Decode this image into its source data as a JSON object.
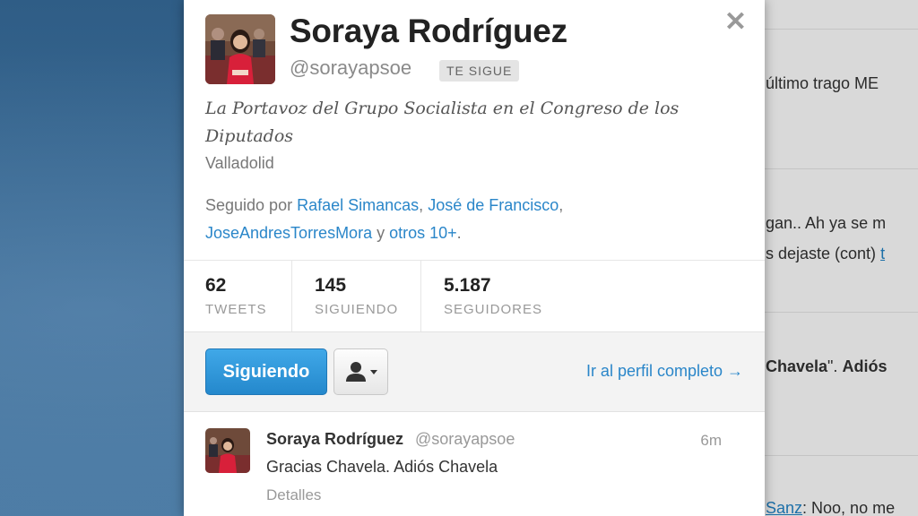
{
  "background_timeline": {
    "rows": [
      {
        "text": "último trago ME"
      },
      {
        "text": "gan.. Ah ya se m"
      },
      {
        "text_prefix": "s dejaste (cont) ",
        "link": "t"
      },
      {
        "quote_bold": "Chavela",
        "after": "\". ",
        "bold_tail": "Adiós"
      },
      {
        "link": "Sanz",
        "after": ": Noo, no me"
      }
    ]
  },
  "profile": {
    "name": "Soraya Rodríguez",
    "handle": "@sorayapsoe",
    "follows_you_badge": "TE SIGUE",
    "bio": "La Portavoz del Grupo Socialista en el Congreso de los Diputados",
    "location": "Valladolid",
    "followed_by": {
      "prefix": "Seguido por",
      "user1": "Rafael Simancas",
      "sep1": ",",
      "user2": "José de Francisco",
      "sep2": ",",
      "user3": "JoseAndresTorresMora",
      "conj": "y",
      "others": "otros 10+",
      "end": "."
    },
    "close_icon": "close-icon"
  },
  "stats": [
    {
      "value": "62",
      "label": "TWEETS"
    },
    {
      "value": "145",
      "label": "SIGUIENDO"
    },
    {
      "value": "5.187",
      "label": "SEGUIDORES"
    }
  ],
  "actions": {
    "following_label": "Siguiendo",
    "user_menu_icon": "user-dropdown-icon",
    "full_profile_label": "Ir al perfil completo →"
  },
  "tweet": {
    "author_name": "Soraya Rodríguez",
    "author_handle": "@sorayapsoe",
    "time": "6m",
    "text": "Gracias Chavela. Adiós Chavela",
    "details_label": "Detalles"
  },
  "colors": {
    "link": "#2a86c9",
    "primary_button": "#2488cc",
    "page_background": "#3a6a93"
  }
}
